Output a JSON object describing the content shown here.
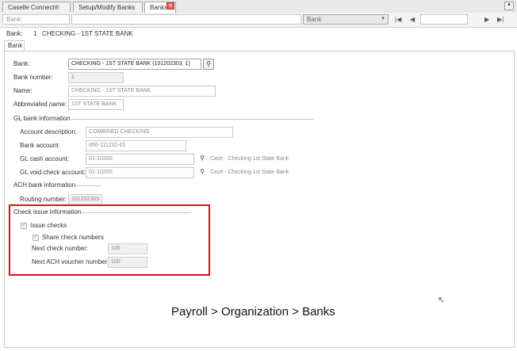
{
  "tabs": [
    {
      "label": "Caselle Connect®"
    },
    {
      "label": "Setup/Modify Banks"
    },
    {
      "label": "Banks"
    }
  ],
  "toolbar": {
    "search_placeholder": "Bank:",
    "select_value": "Bank"
  },
  "header": {
    "bank_label": "Bank:",
    "bank_number": "1",
    "bank_name": "CHECKING - 1ST STATE BANK"
  },
  "subtab": {
    "label": "Bank"
  },
  "form": {
    "bank": {
      "label": "Bank:",
      "value": "CHECKING - 1ST STATE BANK (101202303, 1)"
    },
    "bank_number": {
      "label": "Bank number:",
      "value": "1"
    },
    "name": {
      "label": "Name:",
      "value": "CHECKING - 1ST STATE BANK"
    },
    "abbreviated_name": {
      "label": "Abbreviated name:",
      "value": "1ST STATE BANK"
    },
    "gl_section": {
      "label": "GL bank information"
    },
    "account_description": {
      "label": "Account description:",
      "value": "COMBINED CHECKING"
    },
    "bank_account": {
      "label": "Bank account:",
      "value": "050-111232-01"
    },
    "gl_cash_account": {
      "label": "GL cash account:",
      "value": "01-10200",
      "desc": "Cash - Checking 1st State Bank"
    },
    "gl_void_account": {
      "label": "GL void check account:",
      "value": "01-10200",
      "desc": "Cash - Checking 1st State Bank"
    },
    "ach_section": {
      "label": "ACH bank information"
    },
    "routing_number": {
      "label": "Routing number:",
      "value": "101202303"
    },
    "check_section": {
      "label": "Check issue information"
    },
    "issue_checks": {
      "label": "Issue checks",
      "checked": true
    },
    "share_check_numbers": {
      "label": "Share check numbers",
      "checked": true
    },
    "next_check_number": {
      "label": "Next check number:",
      "value": "100"
    },
    "next_ach_voucher": {
      "label": "Next ACH voucher number:",
      "value": "100"
    }
  },
  "caption": "Payroll > Organization > Banks",
  "colors": {
    "highlight": "#d0161a",
    "close_tab": "#e25b4e"
  },
  "icons": {
    "lookup": "binoculars-icon",
    "close": "close-icon",
    "dropdown": "chevron-down-icon"
  }
}
